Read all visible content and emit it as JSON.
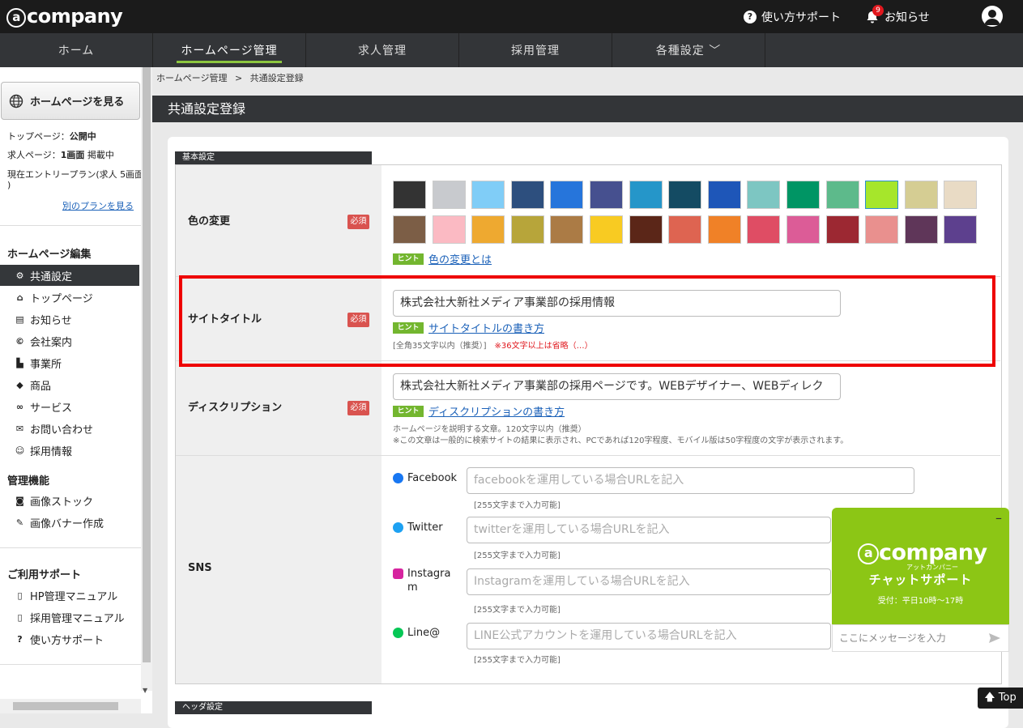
{
  "header": {
    "logo_text": "company",
    "help_label": "使い方サポート",
    "news_label": "お知らせ",
    "news_badge": "9"
  },
  "nav": {
    "items": [
      {
        "label": "ホーム"
      },
      {
        "label": "ホームページ管理",
        "active": true
      },
      {
        "label": "求人管理"
      },
      {
        "label": "採用管理"
      },
      {
        "label": "各種設定 ﹀"
      }
    ]
  },
  "sidebar": {
    "view_hp_label": "ホームページを見る",
    "status_top_key": "トップページ：",
    "status_top_val": "公開中",
    "status_job_key": "求人ページ：",
    "status_job_val": "1画面",
    "status_job_suffix": " 掲載中",
    "status_plan_line1": "現在エントリープラン(求人 5画面",
    "status_plan_line2": ")",
    "other_plan_link": "別のプランを見る",
    "section_edit": "ホームページ編集",
    "edit_items": [
      "共通設定",
      "トップページ",
      "お知らせ",
      "会社案内",
      "事業所",
      "商品",
      "サービス",
      "お問い合わせ",
      "採用情報"
    ],
    "section_manage": "管理機能",
    "manage_items": [
      "画像ストック",
      "画像バナー作成"
    ],
    "section_support": "ご利用サポート",
    "support_items": [
      "HP管理マニュアル",
      "採用管理マニュアル",
      "使い方サポート"
    ]
  },
  "breadcrumb": {
    "parent": "ホームページ管理",
    "sep": ">",
    "current": "共通設定登録"
  },
  "page_title": "共通設定登録",
  "sections": {
    "basic": "基本設定",
    "header": "ヘッダ設定"
  },
  "required_label": "必須",
  "hint_label": "ヒント",
  "color_row": {
    "label": "色の変更",
    "colors": [
      "#333333",
      "#c8cace",
      "#80cdf7",
      "#2d4f7e",
      "#2675db",
      "#46508f",
      "#2596c9",
      "#144b63",
      "#1e56b8",
      "#7dc6c2",
      "#009564",
      "#5dba8b",
      "#a6e62b",
      "#d5cd93",
      "#e9dbc5",
      "#7c5e46",
      "#fbbac3",
      "#eea930",
      "#b7a53a",
      "#ab7b45",
      "#f8cb22",
      "#5b2618",
      "#de6451",
      "#f08127",
      "#df4d64",
      "#dc5c97",
      "#9c2832",
      "#e9908e",
      "#5f3659",
      "#5d408e"
    ],
    "selected_index": 12,
    "hint_link": "色の変更とは"
  },
  "title_row": {
    "label": "サイトタイトル",
    "value": "株式会社大新社メディア事業部の採用情報",
    "hint_link": "サイトタイトルの書き方",
    "note": "[全角35文字以内（推奨）]",
    "note_red": "※36文字以上は省略（…）"
  },
  "desc_row": {
    "label": "ディスクリプション",
    "value": "株式会社大新社メディア事業部の採用ページです。WEBデザイナー、WEBディレク",
    "hint_link": "ディスクリプションの書き方",
    "note1": "ホームページを説明する文章。120文字以内（推奨）",
    "note2": "※この文章は一般的に検索サイトの結果に表示され、PCであれば120字程度、モバイル版は50字程度の文字が表示されます。"
  },
  "sns_row": {
    "label": "SNS",
    "limit_note": "[255文字まで入力可能]",
    "items": [
      {
        "name": "Facebook",
        "placeholder": "facebookを運用している場合URLを記入",
        "color": "#1877f2"
      },
      {
        "name": "Twitter",
        "placeholder": "twitterを運用している場合URLを記入",
        "color": "#1da1f2"
      },
      {
        "name": "Instagram",
        "name_line1": "Instagra",
        "name_line2": "m",
        "placeholder": "Instagramを運用している場合URLを記入",
        "color": "#d6249f"
      },
      {
        "name": "Line@",
        "placeholder": "LINE公式アカウントを運用している場合URLを記入",
        "color": "#06c755"
      }
    ]
  },
  "chat": {
    "logo_text": "company",
    "logo_kana": "アットカンパニー",
    "title": "チャットサポート",
    "hours": "受付：平日10時～17時",
    "input_placeholder": "ここにメッセージを入力",
    "minimize": "–"
  },
  "top_button": "Top"
}
